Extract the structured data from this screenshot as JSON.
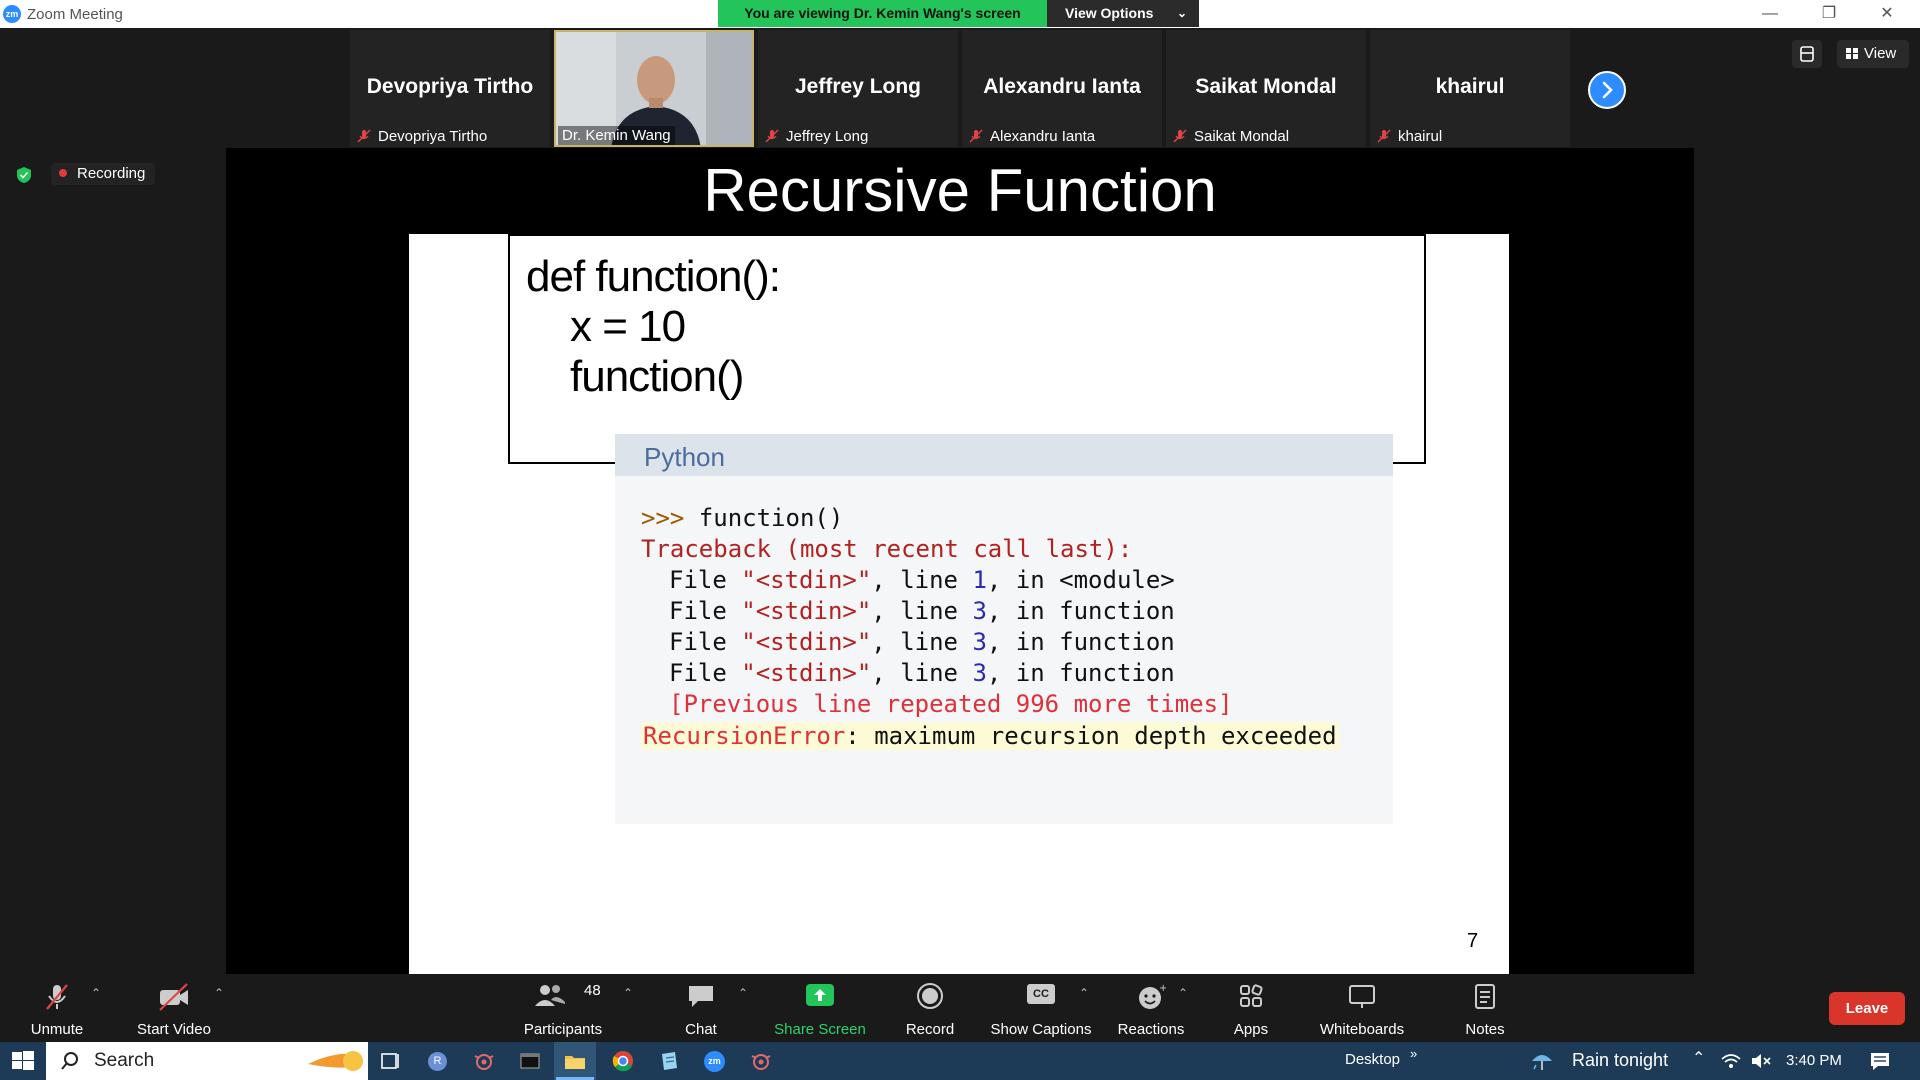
{
  "window": {
    "title": "Zoom Meeting",
    "app_badge": "zm"
  },
  "banner": {
    "viewing": "You are viewing Dr. Kemin Wang's screen",
    "view_options": "View Options"
  },
  "top_controls": {
    "view_label": "View"
  },
  "participants_strip": [
    {
      "big": "Devopriya Tirtho",
      "label": "Devopriya Tirtho",
      "muted": true
    },
    {
      "big": "",
      "label": "Dr. Kemin Wang",
      "muted": false,
      "video": true
    },
    {
      "big": "Jeffrey Long",
      "label": "Jeffrey Long",
      "muted": true
    },
    {
      "big": "Alexandru Ianta",
      "label": "Alexandru Ianta",
      "muted": true
    },
    {
      "big": "Saikat Mondal",
      "label": "Saikat Mondal",
      "muted": true
    },
    {
      "big": "khairul",
      "label": "khairul",
      "muted": true
    }
  ],
  "recording": {
    "label": "Recording"
  },
  "slide": {
    "title": "Recursive Function",
    "code": [
      "def function():",
      "x = 10",
      "function()"
    ],
    "panel_title": "Python",
    "console": {
      "prompt": ">>>",
      "call": " function()",
      "traceback": "Traceback (most recent call last):",
      "frames": [
        {
          "file": "File ",
          "name": "\"<stdin>\"",
          "mid": ", line ",
          "line": "1",
          "end": ", in <module>"
        },
        {
          "file": "File ",
          "name": "\"<stdin>\"",
          "mid": ", line ",
          "line": "3",
          "end": ", in function"
        },
        {
          "file": "File ",
          "name": "\"<stdin>\"",
          "mid": ", line ",
          "line": "3",
          "end": ", in function"
        },
        {
          "file": "File ",
          "name": "\"<stdin>\"",
          "mid": ", line ",
          "line": "3",
          "end": ", in function"
        }
      ],
      "repeated": "[Previous line repeated 996 more times]",
      "error_name": "RecursionError",
      "error_msg": ": maximum recursion depth exceeded"
    },
    "page_number": "7"
  },
  "toolbar": {
    "unmute": "Unmute",
    "start_video": "Start Video",
    "participants": "Participants",
    "participants_count": "48",
    "chat": "Chat",
    "share_screen": "Share Screen",
    "record": "Record",
    "show_captions": "Show Captions",
    "captions_icon_text": "CC",
    "reactions": "Reactions",
    "apps": "Apps",
    "whiteboards": "Whiteboards",
    "notes": "Notes",
    "leave": "Leave"
  },
  "taskbar": {
    "search": "Search",
    "desktop": "Desktop",
    "weather": "Rain tonight",
    "time": "3:40 PM",
    "recent_badge": "R",
    "zoom_badge": "zm"
  },
  "colors": {
    "accent": "#2d8cff",
    "banner_green": "#23c55a",
    "leave_red": "#d9352b",
    "share_green": "#23c55a",
    "traceback_red": "#b22222",
    "error_highlight": "#fdfbd5"
  }
}
